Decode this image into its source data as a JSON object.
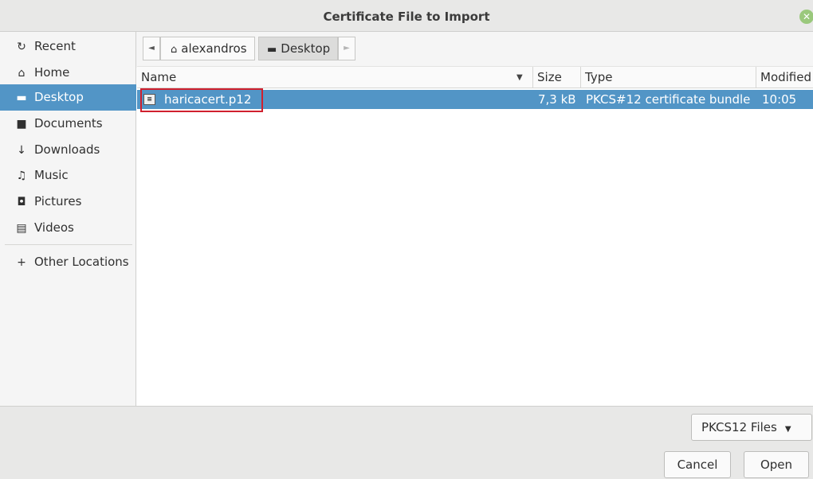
{
  "window": {
    "title": "Certificate File to Import",
    "close_icon": "close-icon"
  },
  "sidebar": {
    "items": [
      {
        "label": "Recent",
        "icon": "clock-icon",
        "glyph": "↻"
      },
      {
        "label": "Home",
        "icon": "home-icon",
        "glyph": "⌂"
      },
      {
        "label": "Desktop",
        "icon": "desktop-icon",
        "glyph": "▬"
      },
      {
        "label": "Documents",
        "icon": "document-icon",
        "glyph": "■"
      },
      {
        "label": "Downloads",
        "icon": "download-icon",
        "glyph": "↓"
      },
      {
        "label": "Music",
        "icon": "music-icon",
        "glyph": "♫"
      },
      {
        "label": "Pictures",
        "icon": "camera-icon",
        "glyph": "◘"
      },
      {
        "label": "Videos",
        "icon": "film-icon",
        "glyph": "▤"
      }
    ],
    "other_locations": {
      "label": "Other Locations",
      "glyph": "+"
    },
    "active": "Desktop"
  },
  "pathbar": {
    "back_glyph": "◄",
    "forward_glyph": "►",
    "crumbs": [
      {
        "label": "alexandros",
        "glyph": "⌂"
      },
      {
        "label": "Desktop",
        "glyph": "▬"
      }
    ]
  },
  "columns": {
    "name": "Name",
    "sort_glyph": "▼",
    "size": "Size",
    "type": "Type",
    "modified": "Modified"
  },
  "files": [
    {
      "name": "haricacert.p12",
      "size": "7,3 kB",
      "type": "PKCS#12 certificate bundle",
      "modified": "10:05",
      "icon_glyph": "≡"
    }
  ],
  "filter": {
    "label": "PKCS12 Files",
    "chev": "▼"
  },
  "buttons": {
    "cancel": "Cancel",
    "open": "Open"
  },
  "colors": {
    "selection": "#5295c6",
    "highlight": "#d0202e"
  }
}
